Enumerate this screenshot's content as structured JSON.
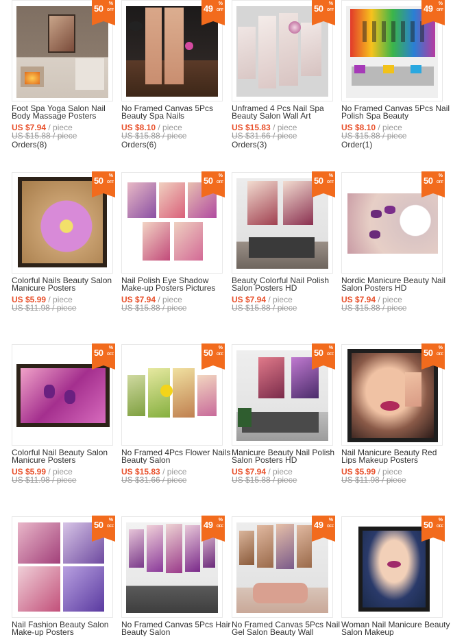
{
  "products": [
    {
      "title": "Foot Spa Yoga Salon Nail Body Massage Posters",
      "discount": "50",
      "price": "US $7.94",
      "unit": "/ piece",
      "old_price": "US $15.88 / piece",
      "orders": "Orders(8)"
    },
    {
      "title": "No Framed Canvas 5Pcs Beauty Spa Nails",
      "discount": "49",
      "price": "US $8.10",
      "unit": "/ piece",
      "old_price": "US $15.88 / piece",
      "orders": "Orders(6)"
    },
    {
      "title": "Unframed 4 Pcs Nail Spa Beauty Salon Wall Art",
      "discount": "50",
      "price": "US $15.83",
      "unit": "/ piece",
      "old_price": "US $31.66 / piece",
      "orders": "Orders(3)"
    },
    {
      "title": "No Framed Canvas 5Pcs Nail Polish Spa Beauty",
      "discount": "49",
      "price": "US $8.10",
      "unit": "/ piece",
      "old_price": "US $15.88 / piece",
      "orders": "Order(1)"
    },
    {
      "title": "Colorful Nails Beauty Salon Manicure Posters",
      "discount": "50",
      "price": "US $5.99",
      "unit": "/ piece",
      "old_price": "US $11.98 / piece",
      "orders": ""
    },
    {
      "title": "Nail Polish Eye Shadow Make-up Posters Pictures",
      "discount": "50",
      "price": "US $7.94",
      "unit": "/ piece",
      "old_price": "US $15.88 / piece",
      "orders": ""
    },
    {
      "title": "Beauty Colorful Nail Polish Salon Posters HD",
      "discount": "50",
      "price": "US $7.94",
      "unit": "/ piece",
      "old_price": "US $15.88 / piece",
      "orders": ""
    },
    {
      "title": "Nordic Manicure Beauty Nail Salon Posters HD",
      "discount": "50",
      "price": "US $7.94",
      "unit": "/ piece",
      "old_price": "US $15.88 / piece",
      "orders": ""
    },
    {
      "title": "Colorful Nail Beauty Salon Manicure Posters",
      "discount": "50",
      "price": "US $5.99",
      "unit": "/ piece",
      "old_price": "US $11.98 / piece",
      "orders": ""
    },
    {
      "title": "No Framed 4Pcs Flower Nails Beauty Salon",
      "discount": "50",
      "price": "US $15.83",
      "unit": "/ piece",
      "old_price": "US $31.66 / piece",
      "orders": ""
    },
    {
      "title": "Manicure Beauty Nail Polish Salon Posters HD",
      "discount": "50",
      "price": "US $7.94",
      "unit": "/ piece",
      "old_price": "US $15.88 / piece",
      "orders": ""
    },
    {
      "title": "Nail Manicure Beauty Red Lips Makeup Posters",
      "discount": "50",
      "price": "US $5.99",
      "unit": "/ piece",
      "old_price": "US $11.98 / piece",
      "orders": ""
    },
    {
      "title": "Nail Fashion Beauty Salon Make-up Posters",
      "discount": "50",
      "price": "",
      "unit": "",
      "old_price": "",
      "orders": ""
    },
    {
      "title": "No Framed Canvas 5Pcs Hair Beauty Salon",
      "discount": "49",
      "price": "",
      "unit": "",
      "old_price": "",
      "orders": ""
    },
    {
      "title": "No Framed Canvas 5Pcs Nail Gel Salon Beauty Wall",
      "discount": "49",
      "price": "",
      "unit": "",
      "old_price": "",
      "orders": ""
    },
    {
      "title": "Woman Nail Manicure Beauty Salon Makeup",
      "discount": "50",
      "price": "",
      "unit": "",
      "old_price": "",
      "orders": ""
    }
  ],
  "badge": {
    "pct": "%",
    "off": "OFF"
  },
  "colors": {
    "badge": "#f26b1d",
    "price": "#e8502b",
    "muted": "#999999",
    "border": "#e8e8e8"
  }
}
